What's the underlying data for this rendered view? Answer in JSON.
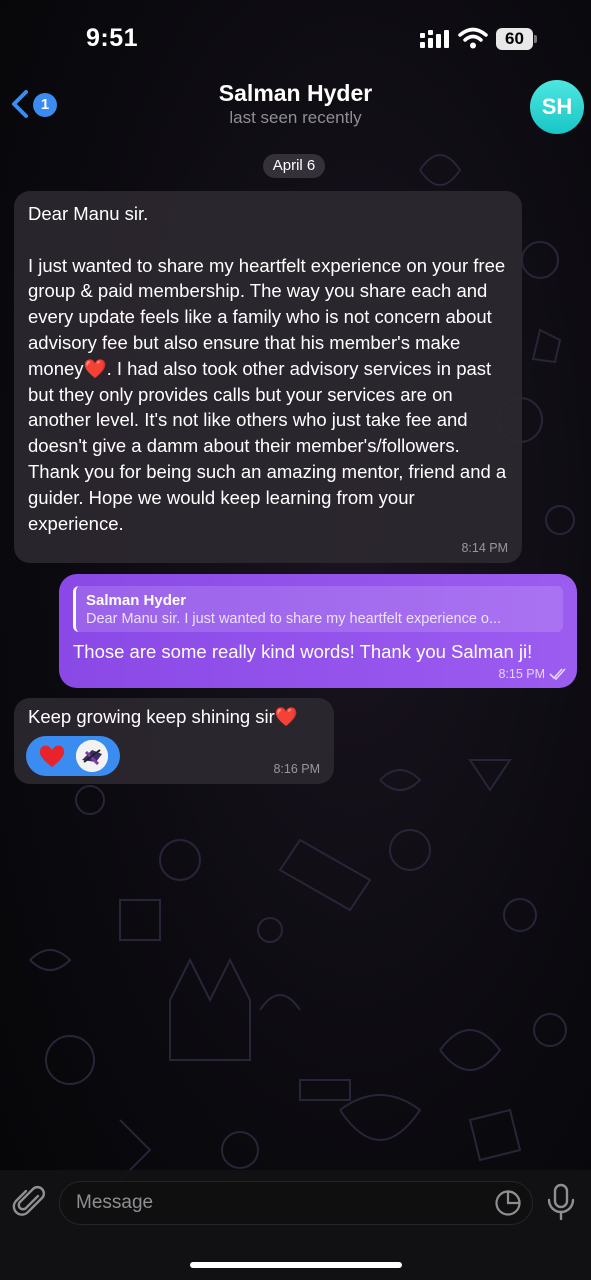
{
  "status_bar": {
    "time": "9:51",
    "battery": "60"
  },
  "header": {
    "back_count": "1",
    "title": "Salman Hyder",
    "subtitle": "last seen recently",
    "avatar_initials": "SH",
    "avatar_color": "#2ad3d3"
  },
  "date_chip": "April 6",
  "messages": [
    {
      "direction": "incoming",
      "text_part1": "Dear Manu sir.\n\nI just wanted to share my heartfelt experience on your free group & paid membership. The way you share each and every update feels like a family who is not concern about advisory fee but also ensure that his member's make money",
      "emoji": "❤️",
      "text_part2": ". I had also took other advisory services in past but they only provides calls but your services are on another level. It's not like others who just take fee and doesn't give a damm about their member's/followers.\nThank you for being such an amazing mentor, friend and a guider. Hope we would keep learning from your experience.",
      "time": "8:14 PM"
    },
    {
      "direction": "outgoing",
      "reply_to_name": "Salman Hyder",
      "reply_to_text": "Dear Manu sir. I just wanted to share my heartfelt experience o...",
      "text": "Those are some really kind words! Thank you Salman ji!",
      "time": "8:15 PM",
      "read": true
    },
    {
      "direction": "incoming",
      "text": "Keep growing keep shining sir",
      "emoji": "❤️",
      "time": "8:16 PM",
      "reactions": [
        "heart",
        "user-avatar"
      ]
    }
  ],
  "input": {
    "placeholder": "Message"
  },
  "colors": {
    "accent_blue": "#3a8cf0",
    "outgoing_bubble": "#9254ea",
    "incoming_bubble": "#2d2830"
  }
}
